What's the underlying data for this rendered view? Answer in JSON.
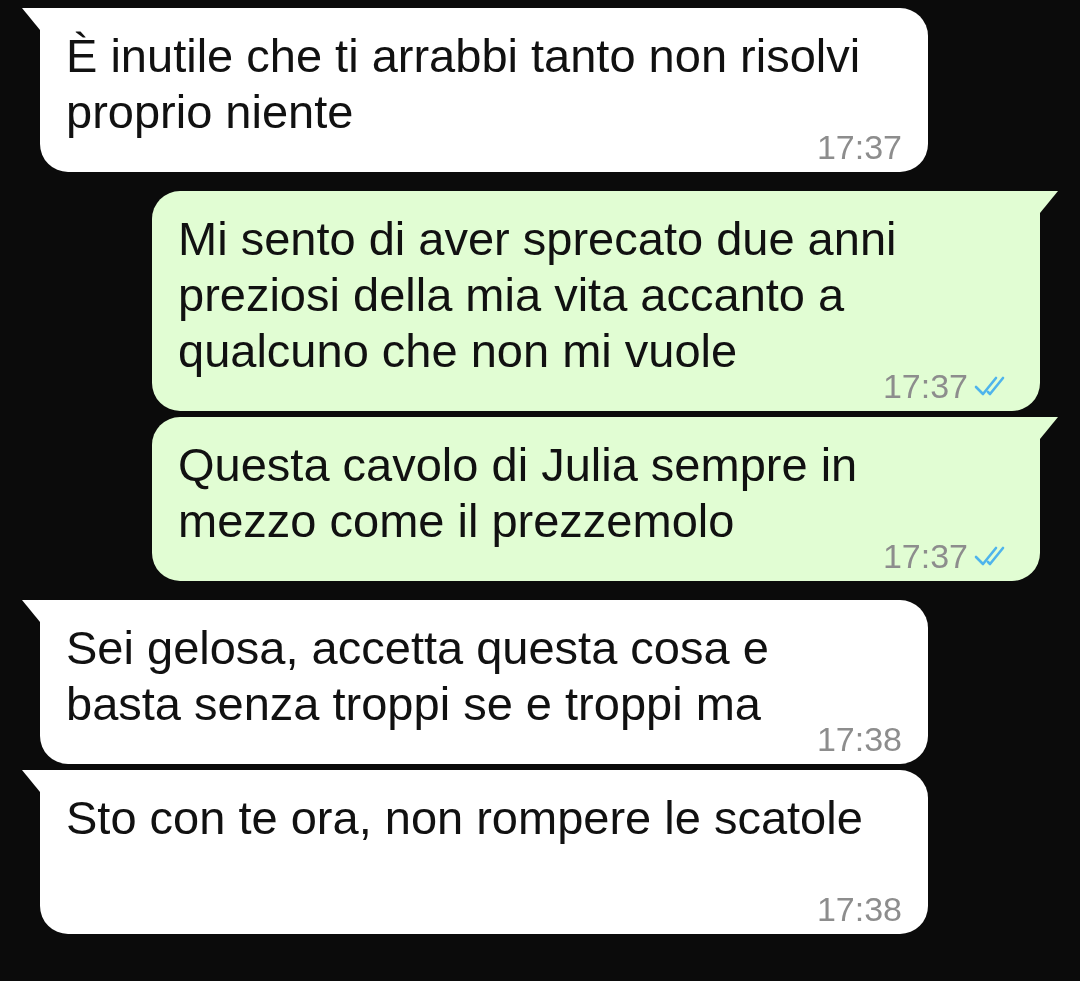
{
  "messages": [
    {
      "kind": "incoming",
      "text": "È inutile che ti arrabbi tanto non risolvi proprio niente",
      "time": "17:37"
    },
    {
      "kind": "outgoing",
      "text": "Mi sento di aver sprecato due anni preziosi della mia vita accanto a qualcuno che non mi vuole",
      "time": "17:37",
      "read": true
    },
    {
      "kind": "outgoing",
      "text": "Questa cavolo di Julia sempre in mezzo come il prezzemolo",
      "time": "17:37",
      "read": true
    },
    {
      "kind": "incoming",
      "text": "Sei gelosa, accetta questa cosa e basta senza troppi se e troppi ma",
      "time": "17:38"
    },
    {
      "kind": "incoming",
      "text": "Sto con te ora, non rompere le scatole",
      "time": "17:38"
    }
  ]
}
